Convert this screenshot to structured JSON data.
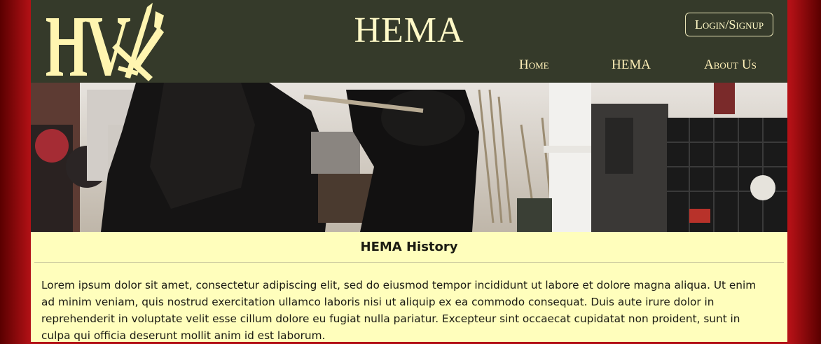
{
  "header": {
    "logo_alt": "HV logo with crossed swords",
    "title": "HEMA",
    "login_label": "Login/Signup"
  },
  "nav": {
    "items": [
      {
        "label": "Home"
      },
      {
        "label": "HEMA"
      },
      {
        "label": "About Us"
      }
    ]
  },
  "banner": {
    "description_icon": "fencing-photo"
  },
  "content": {
    "title": "HEMA History",
    "body": "Lorem ipsum dolor sit amet, consectetur adipiscing elit, sed do eiusmod tempor incididunt ut labore et dolore magna aliqua. Ut enim ad minim veniam, quis nostrud exercitation ullamco laboris nisi ut aliquip ex ea commodo consequat. Duis aute irure dolor in reprehenderit in voluptate velit esse cillum dolore eu fugiat nulla pariatur. Excepteur sint occaecat cupidatat non proident, sunt in culpa qui officia deserunt mollit anim id est laborum."
  },
  "colors": {
    "header_bg": "#353a2a",
    "page_bg": "#fffebc",
    "side_bg": "#b31116",
    "accent_text": "#fff9c7"
  }
}
